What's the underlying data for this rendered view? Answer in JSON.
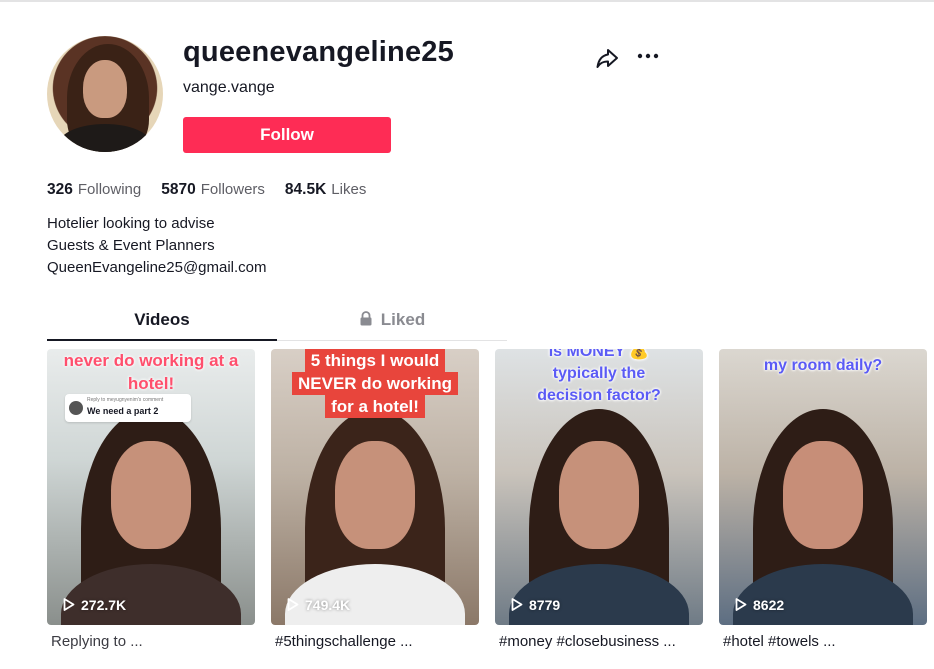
{
  "profile": {
    "username": "queenevangeline25",
    "nickname": "vange.vange",
    "follow_label": "Follow",
    "share_icon": "share-icon",
    "more_icon": "more-icon"
  },
  "stats": [
    {
      "value": "326",
      "label": "Following"
    },
    {
      "value": "5870",
      "label": "Followers"
    },
    {
      "value": "84.5K",
      "label": "Likes"
    }
  ],
  "bio": [
    "Hotelier looking to advise",
    "Guests & Event Planners",
    "QueenEvangeline25@gmail.com"
  ],
  "tabs": [
    {
      "label": "Videos",
      "active": true
    },
    {
      "label": "Liked",
      "active": false,
      "icon": "lock-icon"
    }
  ],
  "videos": [
    {
      "caption": "never do working at a hotel!",
      "reply_chip": {
        "small": "Reply to meyugnyenim's comment",
        "text": "We need a part 2"
      },
      "views": "272.7K",
      "desc": "Replying to ..."
    },
    {
      "caption_lines": [
        "5 things I would",
        "NEVER do working",
        "for a hotel!"
      ],
      "views": "749.4K",
      "desc": "#5thingschallenge ..."
    },
    {
      "caption_lines": [
        "is MONEY 💰",
        "typically the",
        "decision factor?"
      ],
      "views": "8779",
      "desc": "#money #closebusiness ..."
    },
    {
      "caption": "my room daily?",
      "views": "8622",
      "desc": "#hotel #towels ..."
    }
  ],
  "colors": {
    "accent": "#fe2c55",
    "text": "#161823",
    "muted": "#8a8b91"
  }
}
